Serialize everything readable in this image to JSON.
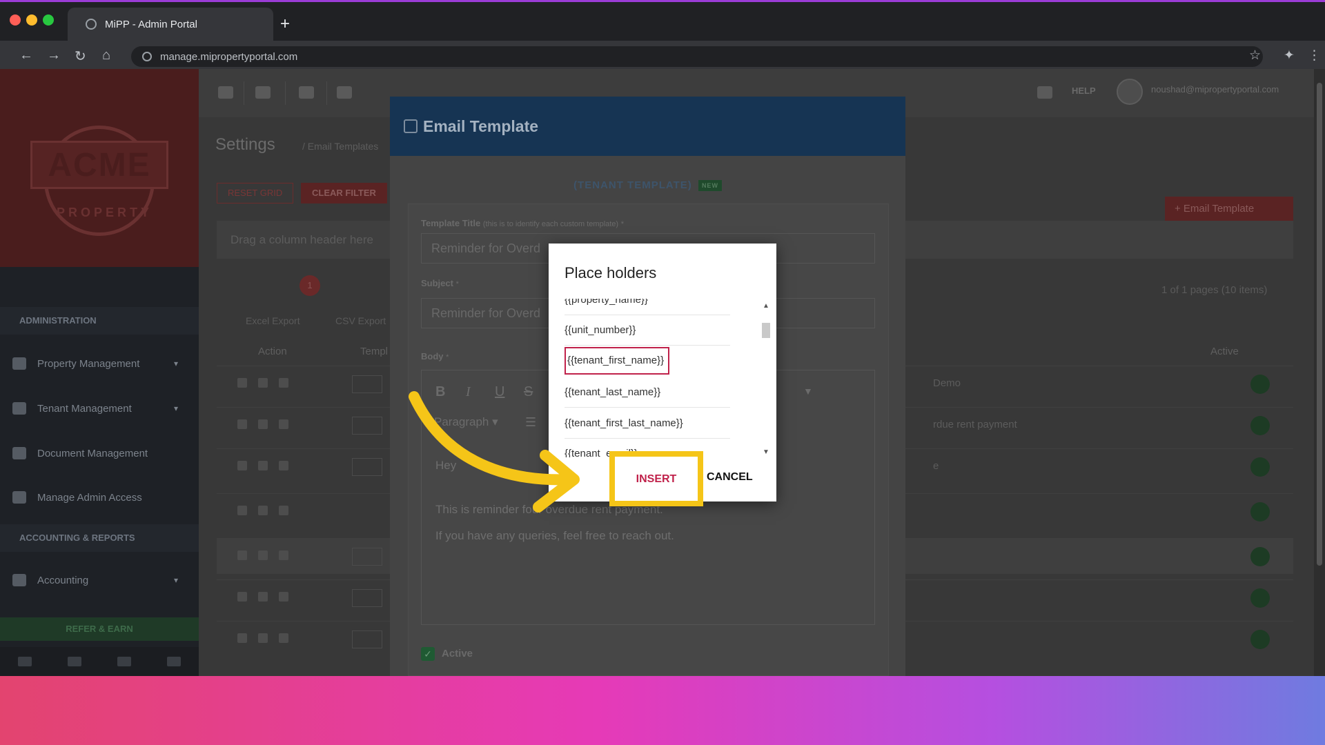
{
  "browser": {
    "tab_title": "MiPP - Admin Portal",
    "url": "manage.mipropertyportal.com",
    "new_tab": "+",
    "back": "←",
    "forward": "→",
    "reload": "↻",
    "home": "⌂",
    "star": "☆",
    "extensions": "✦",
    "menu": "⋮"
  },
  "logo": {
    "name": "ACME",
    "sub": "PROPERTY"
  },
  "sidebar": {
    "sections": [
      {
        "title": "ADMINISTRATION"
      },
      {
        "title": "ACCOUNTING & REPORTS"
      }
    ],
    "items": [
      {
        "label": "Property Management",
        "icon": "building-icon"
      },
      {
        "label": "Tenant Management",
        "icon": "users-icon"
      },
      {
        "label": "Document Management",
        "icon": "document-icon"
      },
      {
        "label": "Manage Admin Access",
        "icon": "key-icon"
      },
      {
        "label": "Accounting",
        "icon": "money-icon"
      }
    ],
    "refer": "REFER & EARN"
  },
  "topbar": {
    "help": "HELP",
    "user": "noushad@mipropertyportal.com",
    "more": "···",
    "plus": "+"
  },
  "content": {
    "title": "Settings",
    "breadcrumb": "/ Email Templates",
    "reset_grid": "RESET GRID",
    "clear_filter": "CLEAR FILTER",
    "add_template": "+ Email Template",
    "drag_hint": "Drag a column header here",
    "page_current": "1",
    "pages_info": "1 of 1 pages (10 items)",
    "excel_export": "Excel Export",
    "csv_export": "CSV Export",
    "columns": {
      "action": "Action",
      "template": "Templ",
      "active": "Active"
    },
    "row_texts": [
      "Demo",
      "rdue rent payment",
      "e"
    ]
  },
  "template_modal": {
    "title": "Email Template",
    "kind": "(TENANT TEMPLATE)",
    "badge": "NEW",
    "title_label": "Template Title",
    "title_hint": "(this is to identify each custom template)",
    "required": "*",
    "title_value": "Reminder for Overd",
    "subject_label": "Subject",
    "subject_value": "Reminder for Overd",
    "body_label": "Body",
    "bold": "B",
    "italic": "I",
    "underline": "U",
    "strike": "S",
    "paragraph": "Paragraph",
    "body_lines": [
      "Hey",
      "This is reminder fo",
      "ur overdue rent payment.",
      "If you have any queries, feel free to reach out."
    ],
    "active_label": "Active"
  },
  "placeholders": {
    "title": "Place holders",
    "items": [
      "{{property_name}}",
      "{{unit_number}}",
      "{{tenant_first_name}}",
      "{{tenant_last_name}}",
      "{{tenant_first_last_name}}",
      "{{tenant_email}}"
    ],
    "selected_index": 2,
    "insert": "INSERT",
    "cancel": "CANCEL"
  },
  "colors": {
    "accent": "#c0214a",
    "highlight": "#f5c518",
    "modal_header": "#163453"
  }
}
